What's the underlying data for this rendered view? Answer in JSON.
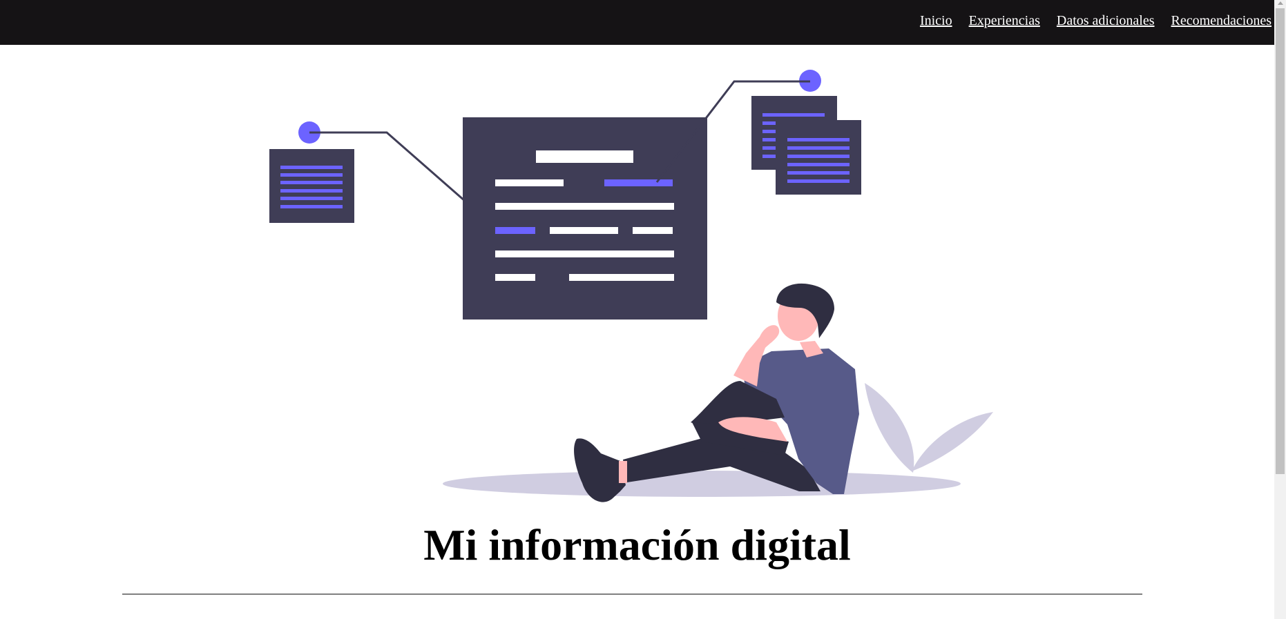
{
  "nav": {
    "items": [
      {
        "label": "Inicio"
      },
      {
        "label": "Experiencias"
      },
      {
        "label": "Datos adicionales"
      },
      {
        "label": "Recomendaciones"
      }
    ]
  },
  "hero": {
    "illustration": "person-reading-documents-illustration"
  },
  "main": {
    "title": "Mi información digital"
  },
  "colors": {
    "navbar_bg": "#151315",
    "accent": "#6c63ff",
    "document_dark": "#3f3d56",
    "shirt": "#575a89",
    "skin": "#ffb8b8",
    "pants": "#2f2e41",
    "shadow": "#d0cde1"
  }
}
